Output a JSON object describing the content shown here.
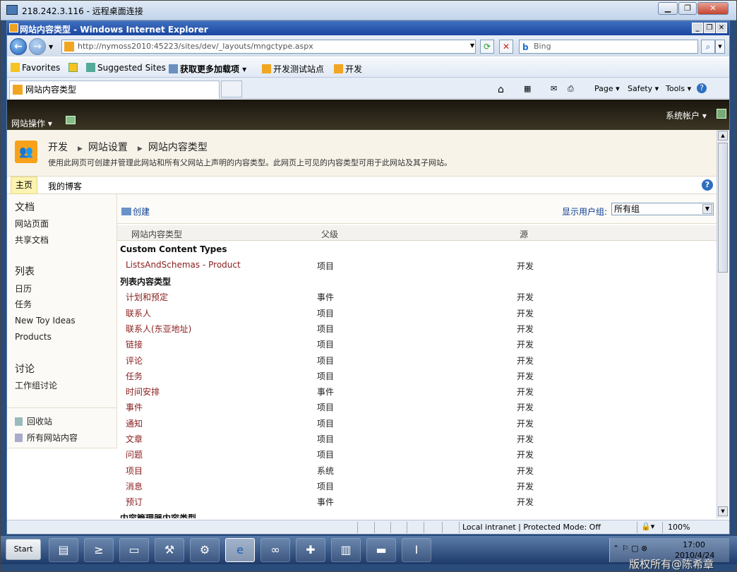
{
  "rdp": {
    "title": "218.242.3.116 - 远程桌面连接"
  },
  "ie": {
    "title": "网站内容类型 - Windows Internet Explorer",
    "address": "http://nymoss2010:45223/sites/dev/_layouts/mngctype.aspx",
    "search_placeholder": "Bing",
    "favorites": [
      "Favorites",
      "Suggested Sites ▾",
      "获取更多加载项 ▾",
      "开发测试站点",
      "开发"
    ],
    "tab_title": "网站内容类型",
    "toolbar": [
      "Page ▾",
      "Safety ▾",
      "Tools ▾"
    ],
    "status": {
      "zone": "Local intranet | Protected Mode: Off",
      "zoom": "100%"
    }
  },
  "ribbon": {
    "site_actions": "网站操作 ▾",
    "account": "系统帐户 ▾"
  },
  "header": {
    "breadcrumb": [
      "开发",
      "网站设置",
      "网站内容类型"
    ],
    "description": "使用此网页可创建并管理此网站和所有父网站上声明的内容类型。此网页上可见的内容类型可用于此网站及其子网站。"
  },
  "topnav": {
    "home": "主页",
    "blog": "我的博客"
  },
  "quicklaunch": {
    "docs_header": "文档",
    "docs": [
      "网站页面",
      "共享文档"
    ],
    "lists_header": "列表",
    "lists": [
      "日历",
      "任务",
      "New Toy Ideas",
      "Products"
    ],
    "disc_header": "讨论",
    "disc": [
      "工作组讨论"
    ],
    "recycle": "回收站",
    "all_content": "所有网站内容"
  },
  "main": {
    "create": "创建",
    "group_label": "显示用户组:",
    "group_value": "所有组",
    "columns": [
      "网站内容类型",
      "父级",
      "源"
    ],
    "groups": [
      {
        "name": "Custom Content Types",
        "rows": [
          [
            "ListsAndSchemas - Product",
            "项目",
            "开发"
          ]
        ]
      },
      {
        "name": "列表内容类型",
        "rows": [
          [
            "计划和预定",
            "事件",
            "开发"
          ],
          [
            "联系人",
            "项目",
            "开发"
          ],
          [
            "联系人(东亚地址)",
            "项目",
            "开发"
          ],
          [
            "链接",
            "项目",
            "开发"
          ],
          [
            "评论",
            "项目",
            "开发"
          ],
          [
            "任务",
            "项目",
            "开发"
          ],
          [
            "时间安排",
            "事件",
            "开发"
          ],
          [
            "事件",
            "项目",
            "开发"
          ],
          [
            "通知",
            "项目",
            "开发"
          ],
          [
            "文章",
            "项目",
            "开发"
          ],
          [
            "问题",
            "项目",
            "开发"
          ],
          [
            "项目",
            "系统",
            "开发"
          ],
          [
            "消息",
            "项目",
            "开发"
          ],
          [
            "预订",
            "事件",
            "开发"
          ]
        ]
      },
      {
        "name": "内容管理器内容类型",
        "rows": []
      }
    ]
  },
  "taskbar": {
    "start": "Start",
    "time": "17:00",
    "date": "2010/4/24"
  },
  "watermark": "版权所有@陈希章"
}
